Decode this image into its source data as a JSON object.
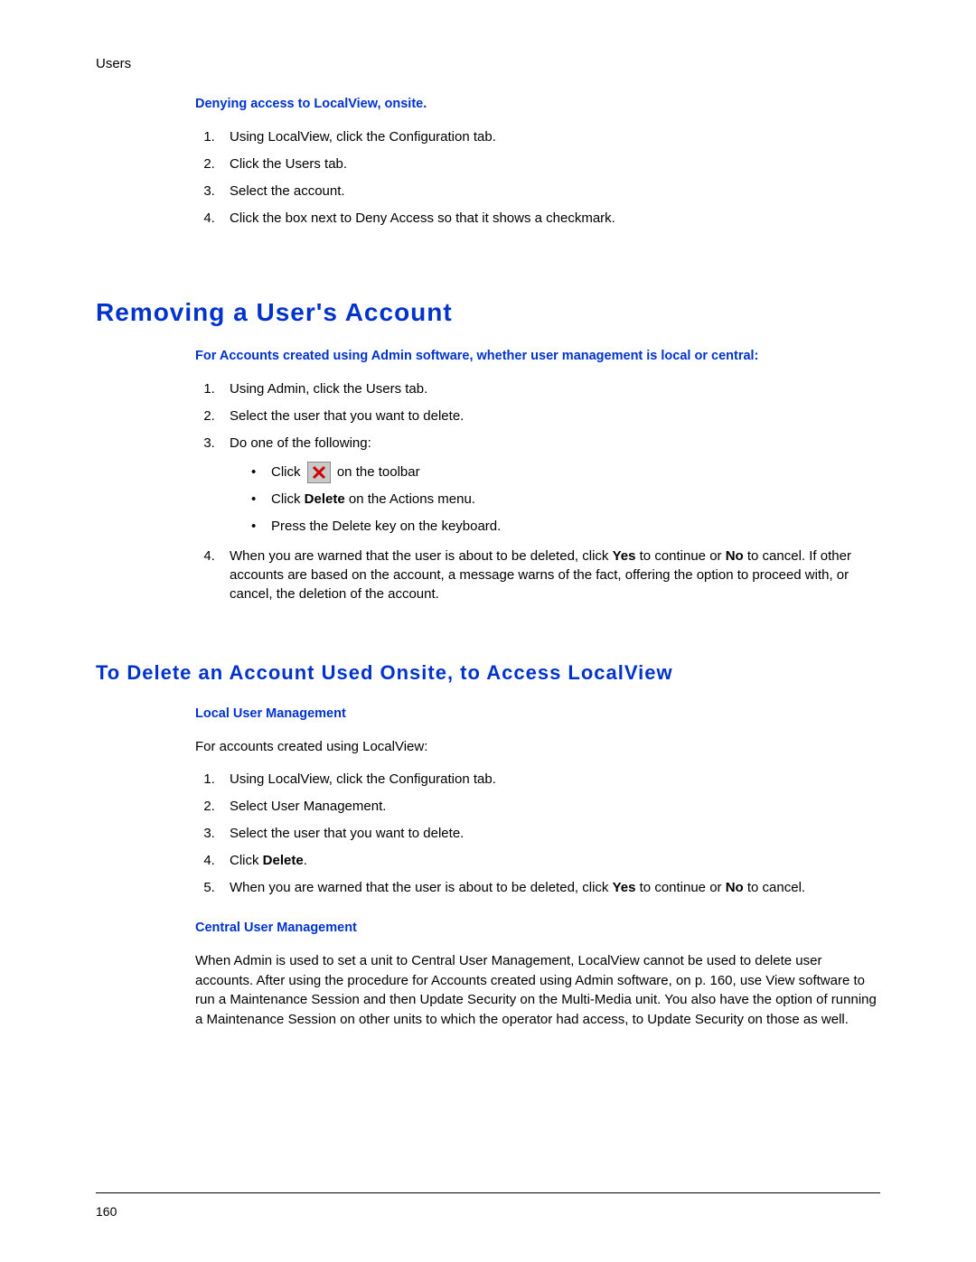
{
  "header": {
    "label": "Users"
  },
  "sec1": {
    "heading": "Denying access to LocalView, onsite.",
    "steps": [
      "Using LocalView, click the Configuration tab.",
      "Click the Users tab.",
      "Select the account.",
      "Click the box next to Deny Access so that it shows a checkmark."
    ]
  },
  "sec2": {
    "title": "Removing a User's Account",
    "subhead": "For Accounts created using Admin software, whether user management is local or central:",
    "steps": {
      "s1": "Using Admin, click the Users tab.",
      "s2": "Select the user that you want to delete.",
      "s3": "Do one of the following:",
      "bul": {
        "b1_pre": "Click ",
        "b1_post": " on the toolbar",
        "b2_pre": "Click ",
        "b2_bold": "Delete",
        "b2_post": " on the Actions menu.",
        "b3": "Press the Delete key on the keyboard."
      },
      "s4_pre": "When you are warned that the user is about to be deleted, click ",
      "s4_yes": "Yes",
      "s4_mid": " to continue or ",
      "s4_no": "No",
      "s4_post": " to cancel. If other accounts are based on the account, a message warns of the fact, offering the option to proceed with, or cancel, the deletion of the account."
    }
  },
  "sec3": {
    "title": "To Delete an Account Used Onsite, to Access LocalView",
    "local": {
      "heading": "Local User Management",
      "intro": "For accounts created using LocalView:",
      "steps": {
        "s1": "Using LocalView, click the Configuration tab.",
        "s2": "Select User Management.",
        "s3": "Select the user that you want to delete.",
        "s4_pre": "Click ",
        "s4_bold": "Delete",
        "s4_post": ".",
        "s5_pre": "When you are warned that the user is about to be deleted, click ",
        "s5_yes": "Yes",
        "s5_mid": " to continue or ",
        "s5_no": "No",
        "s5_post": " to cancel."
      }
    },
    "central": {
      "heading": "Central User Management",
      "para": "When Admin is used to set a unit to Central User Management, LocalView cannot be used to delete user accounts. After using the procedure for Accounts created using Admin software, on p. 160, use View software to run a Maintenance Session and then Update Security on the Multi-Media unit. You also have the option of running a Maintenance Session on other units to which the operator had access, to Update Security on those as well."
    }
  },
  "footer": {
    "page": "160"
  }
}
